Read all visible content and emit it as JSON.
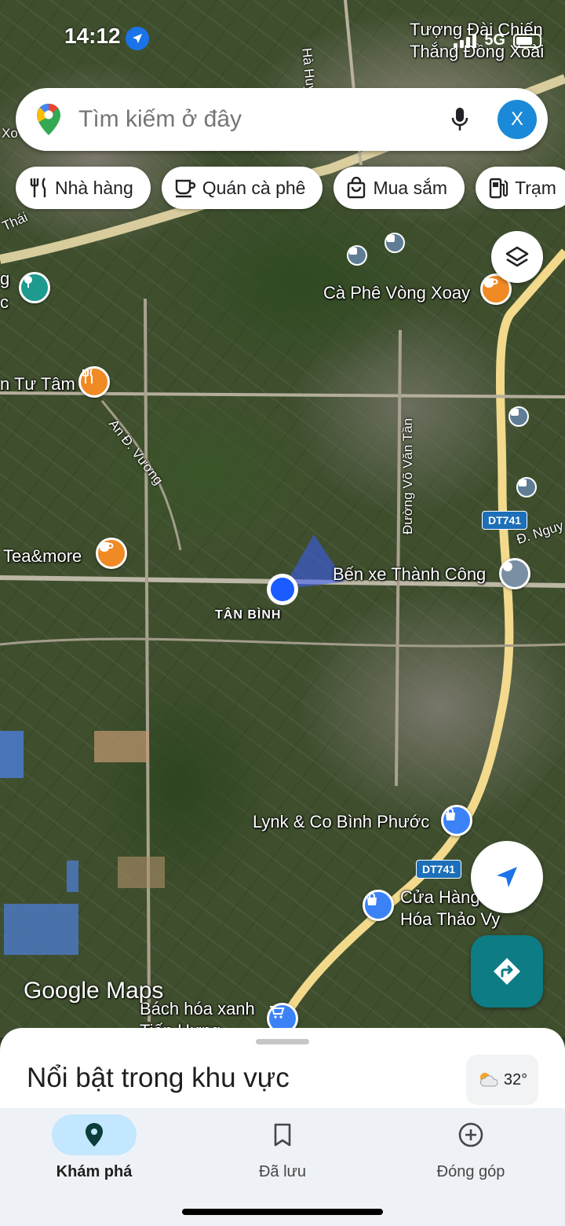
{
  "status_bar": {
    "time": "14:12",
    "network": "5G",
    "icons": [
      "location-arrow-icon",
      "signal-icon",
      "battery-icon"
    ]
  },
  "search": {
    "placeholder": "Tìm kiếm ở đây",
    "avatar_initial": "X"
  },
  "chips": [
    {
      "label": "Nhà hàng",
      "icon": "restaurant-icon"
    },
    {
      "label": "Quán cà phê",
      "icon": "coffee-icon"
    },
    {
      "label": "Mua sắm",
      "icon": "shopping-bag-icon"
    },
    {
      "label": "Trạm",
      "icon": "gas-station-icon"
    }
  ],
  "map": {
    "pois": [
      {
        "label": "Tượng Đài Chiến",
        "label2": "Thắng Đồng Xoài"
      },
      {
        "label": "Cà Phê Vòng Xoay",
        "icon": "coffee-icon"
      },
      {
        "label": "n Tư Tâm",
        "icon": "restaurant-icon"
      },
      {
        "label": "Tea&more",
        "icon": "coffee-icon"
      },
      {
        "label": "Bến xe Thành Công",
        "icon": "bus-terminal-icon"
      },
      {
        "label": "Lynk & Co Bình Phước",
        "icon": "shopping-icon"
      },
      {
        "label": "Cửa Hàng",
        "label2": "Hóa Thảo Vy",
        "icon": "shopping-icon"
      },
      {
        "label": "Bách hóa xanh",
        "label2": "Tiến Hưng",
        "icon": "cart-icon"
      }
    ],
    "area_label": "TÂN BÌNH",
    "road_labels": [
      "Hà Huy Tập",
      "An Đ. Vương",
      "Đường Võ Văn Tần",
      "Đ. Nguy",
      "Thái",
      "Xo"
    ],
    "route_badges": [
      "DT741",
      "DT741"
    ],
    "left_edge_labels": [
      "g",
      "c"
    ],
    "watermark": "Google Maps"
  },
  "bottom_sheet": {
    "title": "Nổi bật trong khu vực",
    "weather": "32°",
    "weather_icon": "partly-cloudy-icon"
  },
  "bottom_nav": [
    {
      "label": "Khám phá",
      "icon": "location-pin-icon",
      "active": true
    },
    {
      "label": "Đã lưu",
      "icon": "bookmark-icon",
      "active": false
    },
    {
      "label": "Đóng góp",
      "icon": "add-circle-icon",
      "active": false
    }
  ],
  "colors": {
    "accent": "#1a73e8",
    "directions": "#0d7c85",
    "active_tab_bg": "#c2e7ff",
    "poi_orange": "#f08a24"
  }
}
